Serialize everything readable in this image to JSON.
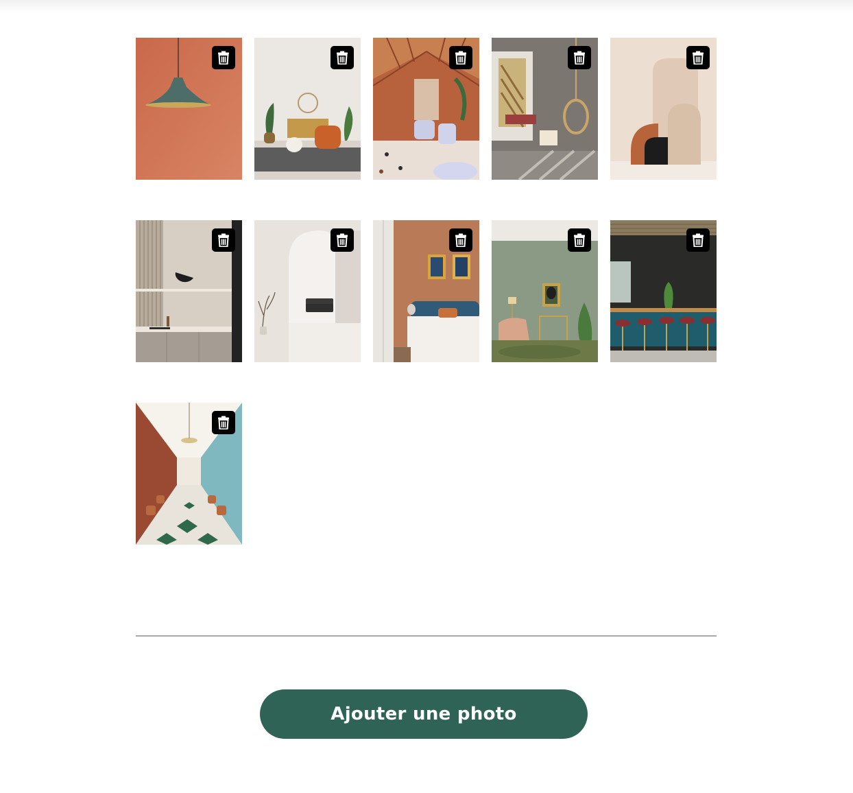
{
  "gallery": {
    "photos": [
      {
        "subject": "pendant-lamp-on-terracotta-wall",
        "delete_icon": "trash-icon"
      },
      {
        "subject": "living-room-orange-armchair",
        "delete_icon": "trash-icon"
      },
      {
        "subject": "greenhouse-restaurant",
        "delete_icon": "trash-icon"
      },
      {
        "subject": "sunlit-nook-hanging-chair",
        "delete_icon": "trash-icon"
      },
      {
        "subject": "beige-arch-shapes",
        "delete_icon": "trash-icon"
      },
      {
        "subject": "minimal-kitchen-shelf",
        "delete_icon": "trash-icon"
      },
      {
        "subject": "white-arch-room-black-sofa",
        "delete_icon": "trash-icon"
      },
      {
        "subject": "bedroom-blue-headboard",
        "delete_icon": "trash-icon"
      },
      {
        "subject": "green-room-pink-armchair",
        "delete_icon": "trash-icon"
      },
      {
        "subject": "teal-bar-red-stools",
        "delete_icon": "trash-icon"
      },
      {
        "subject": "long-restaurant-checkered-floor",
        "delete_icon": "trash-icon"
      }
    ]
  },
  "actions": {
    "add_photo_label": "Ajouter une photo"
  },
  "colors": {
    "primary_button": "#2f6355",
    "delete_button": "#000000",
    "divider": "#a9a9a9"
  }
}
